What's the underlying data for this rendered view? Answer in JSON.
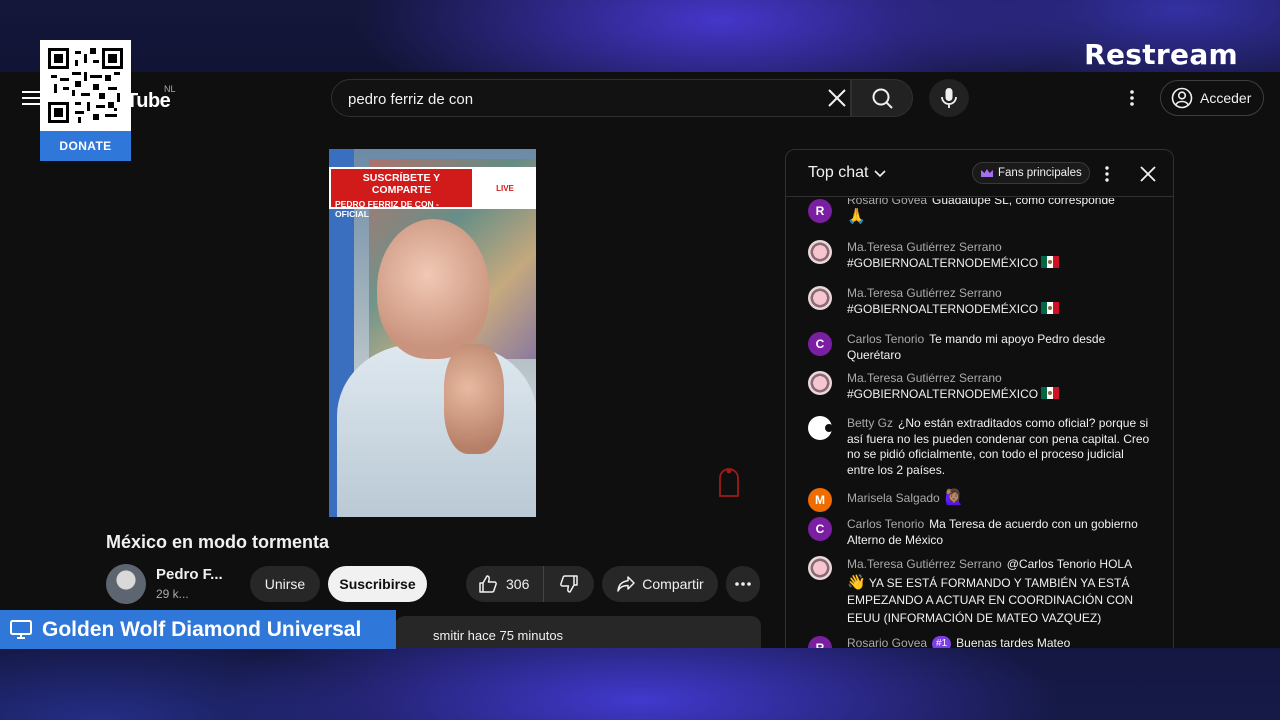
{
  "brand": {
    "name": "Restream"
  },
  "donate_card": {
    "label": "DONATE"
  },
  "youtube": {
    "logo_text": "Tube",
    "country_code": "NL",
    "search": {
      "value": "pedro ferriz de con"
    },
    "signin_label": "Acceder"
  },
  "video": {
    "banner_line1": "SUSCRÍBETE Y COMPARTE",
    "banner_line2": "PEDRO FERRIZ DE CON - OFICIAL",
    "live_badge": "LIVE",
    "title": "México en modo tormenta",
    "channel_name": "Pedro F...",
    "channel_subs": "29 k...",
    "join_label": "Unirse",
    "subscribe_label": "Suscribirse",
    "like_count": "306",
    "share_label": "Compartir",
    "description_preview": "smitir hace 75 minutos"
  },
  "chat": {
    "mode_label": "Top chat",
    "fans_label": "Fans principales",
    "messages": [
      {
        "author": "Rosario Govea",
        "text": "Guadalupe SL, como corresponde",
        "avatar_letter": "R",
        "avatar_color": "#7b1fa2",
        "emoji": "🙏"
      },
      {
        "author": "Ma.Teresa Gutiérrez Serrano",
        "text": "#GOBIERNOALTERNODEMÉXICO",
        "flag": "mexico-flag"
      },
      {
        "author": "Ma.Teresa Gutiérrez Serrano",
        "text": "#GOBIERNOALTERNODEMÉXICO",
        "flag": "mexico-flag"
      },
      {
        "author": "Carlos Tenorio",
        "text": "Te mando mi apoyo Pedro desde Querétaro",
        "avatar_letter": "C",
        "avatar_color": "#7b1fa2"
      },
      {
        "author": "Ma.Teresa Gutiérrez Serrano",
        "text": "#GOBIERNOALTERNODEMÉXICO",
        "flag": "mexico-flag"
      },
      {
        "author": "Betty Gz",
        "text": "¿No están extraditados como oficial? porque si así fuera no les pueden condenar con pena capital. Creo no se pidió oficialmente, con todo el proceso judicial entre los 2 países."
      },
      {
        "author": "Marisela Salgado",
        "text": "",
        "avatar_letter": "M",
        "avatar_color": "#ef6c00",
        "emoji": "🙋🏽‍♀️"
      },
      {
        "author": "Carlos Tenorio",
        "text": "Ma Teresa de acuerdo con un gobierno Alterno de México",
        "avatar_letter": "C",
        "avatar_color": "#7b1fa2"
      },
      {
        "author": "Ma.Teresa Gutiérrez Serrano",
        "text_pre": "@Carlos Tenorio HOLA",
        "emoji": "👋",
        "text": "YA SE ESTÁ FORMANDO Y TAMBIÉN YA ESTÁ EMPEZANDO A ACTUAR EN COORDINACIÓN CON EEUU (INFORMACIÓN DE MATEO VAZQUEZ)"
      },
      {
        "author": "Rosario Govea",
        "badge": "#1",
        "text": "Buenas tardes Mateo",
        "avatar_letter": "R",
        "avatar_color": "#7b1fa2"
      }
    ]
  },
  "name_bar": {
    "label": "Golden Wolf Diamond Universal"
  },
  "colors": {
    "accent_blue": "#2f77d9",
    "youtube_bg": "#0f0f0f",
    "banner_red": "#d11a1a"
  }
}
